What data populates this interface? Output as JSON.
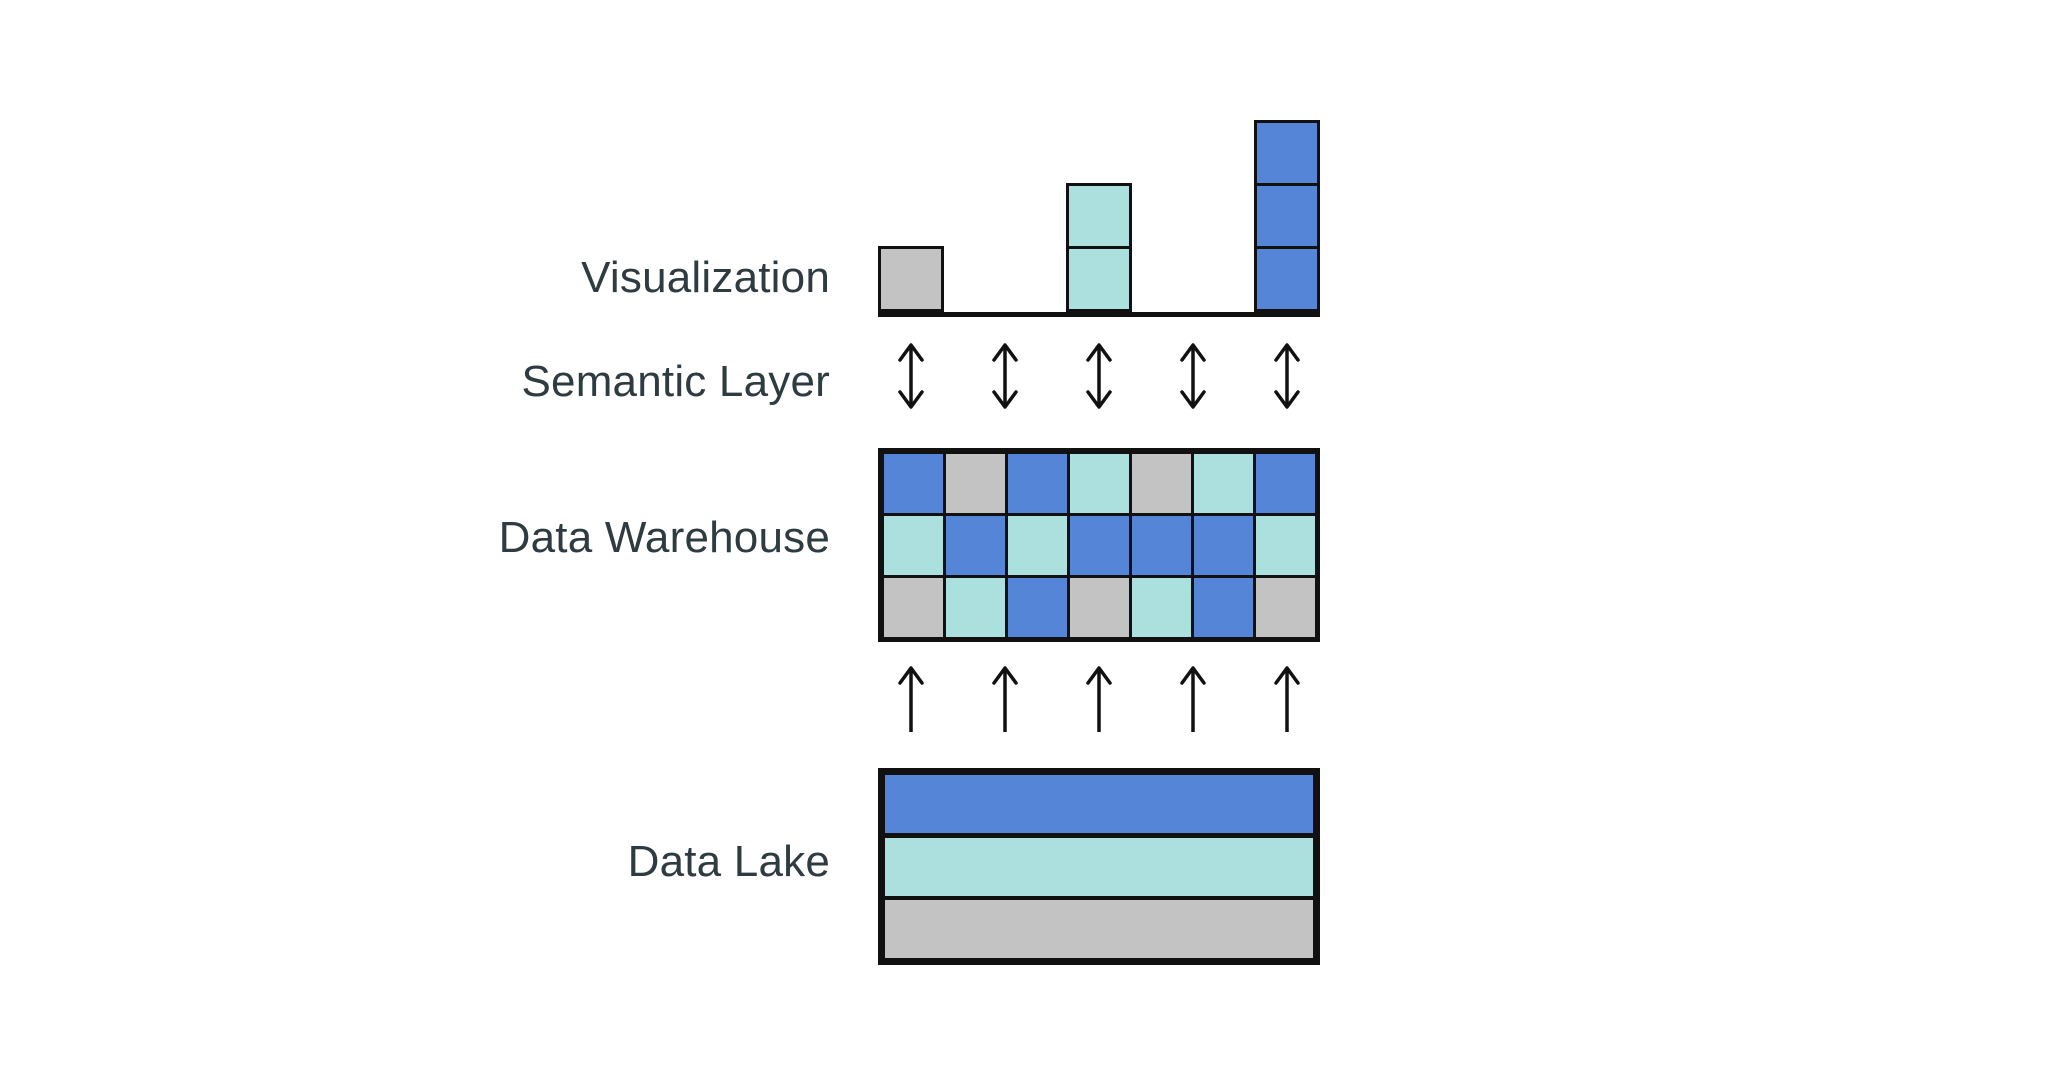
{
  "diagram": {
    "title": "Data stack layers diagram",
    "palette": {
      "blue": "#5585D6",
      "teal": "#ACE0DE",
      "gray": "#C3C3C3",
      "stroke": "#111111",
      "text": "#2E3B40",
      "background": "#FFFFFF"
    },
    "layers": [
      {
        "id": "visualization",
        "label": "Visualization"
      },
      {
        "id": "semantic-layer",
        "label": "Semantic Layer"
      },
      {
        "id": "data-warehouse",
        "label": "Data Warehouse"
      },
      {
        "id": "data-lake",
        "label": "Data Lake"
      }
    ],
    "visualization": {
      "label": "Visualization",
      "slot_count": 5,
      "baseline": true,
      "bars": [
        {
          "slot": 1,
          "blocks": [
            "gray"
          ]
        },
        {
          "slot": 2,
          "blocks": []
        },
        {
          "slot": 3,
          "blocks": [
            "teal",
            "teal"
          ]
        },
        {
          "slot": 4,
          "blocks": []
        },
        {
          "slot": 5,
          "blocks": [
            "blue",
            "blue",
            "blue"
          ]
        }
      ]
    },
    "semantic_layer": {
      "label": "Semantic Layer",
      "connector_icon": "double-headed-vertical-arrow-icon",
      "connector_count": 5,
      "direction": "bidirectional"
    },
    "data_warehouse": {
      "label": "Data Warehouse",
      "columns": 7,
      "rows": 3,
      "cells": [
        [
          "blue",
          "gray",
          "blue",
          "teal",
          "gray",
          "teal",
          "blue"
        ],
        [
          "teal",
          "blue",
          "teal",
          "blue",
          "blue",
          "blue",
          "teal"
        ],
        [
          "gray",
          "teal",
          "blue",
          "gray",
          "teal",
          "blue",
          "gray"
        ]
      ]
    },
    "ingestion": {
      "connector_icon": "up-arrow-icon",
      "connector_count": 5,
      "direction": "upward"
    },
    "data_lake": {
      "label": "Data Lake",
      "bands": [
        "blue",
        "teal",
        "gray"
      ]
    }
  },
  "chart_data": {
    "type": "bar",
    "title": "Visualization",
    "xlabel": "",
    "ylabel": "",
    "categories": [
      "1",
      "2",
      "3",
      "4",
      "5"
    ],
    "values": [
      1,
      0,
      2,
      0,
      3
    ],
    "ylim": [
      0,
      3
    ],
    "grid": false,
    "legend": "none",
    "bar_colors": [
      "#C3C3C3",
      "none",
      "#ACE0DE",
      "none",
      "#5585D6"
    ],
    "notes": "Stacked unit blocks; each block equals one unit. Empty slots have zero blocks."
  }
}
